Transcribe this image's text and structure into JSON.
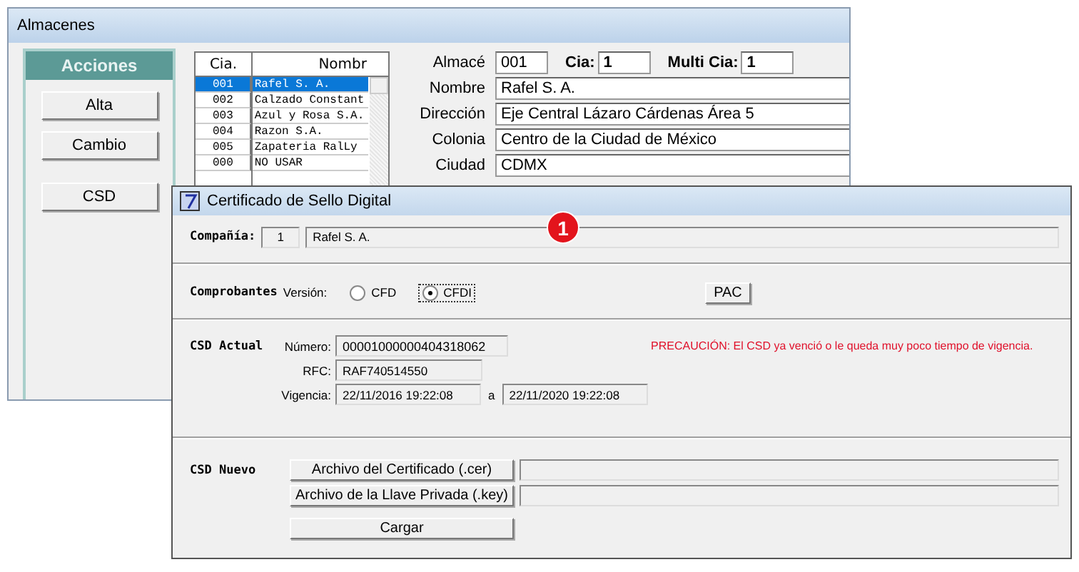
{
  "main_window": {
    "title": "Almacenes",
    "actions": {
      "title": "Acciones",
      "buttons": [
        "Alta",
        "Cambio",
        "CSD"
      ]
    },
    "company_grid": {
      "columns": [
        "Cia.",
        "Nombr"
      ],
      "rows": [
        {
          "cells": [
            "001",
            "Rafel S. A."
          ],
          "selected": true
        },
        {
          "cells": [
            "002",
            "Calzado Constant"
          ],
          "selected": false
        },
        {
          "cells": [
            "003",
            "Azul y Rosa S.A."
          ],
          "selected": false
        },
        {
          "cells": [
            "004",
            "Razon S.A."
          ],
          "selected": false
        },
        {
          "cells": [
            "005",
            "Zapateria RalLy"
          ],
          "selected": false
        },
        {
          "cells": [
            "000",
            "NO USAR"
          ],
          "selected": false
        }
      ]
    },
    "form": {
      "almacen": {
        "label": "Almacé",
        "value": "001"
      },
      "cia": {
        "label": "Cia:",
        "value": "1"
      },
      "multi_cia": {
        "label": "Multi Cia:",
        "value": "1"
      },
      "fields": [
        {
          "label": "Nombre",
          "value": "Rafel S. A."
        },
        {
          "label": "Dirección",
          "value": "Eje Central Lázaro Cárdenas Área 5"
        },
        {
          "label": "Colonia",
          "value": "Centro de la Ciudad de México"
        },
        {
          "label": "Ciudad",
          "value": "CDMX"
        }
      ]
    }
  },
  "dialog": {
    "title": "Certificado de Sello Digital",
    "badge": "1",
    "company": {
      "label": "Compañía:",
      "number": "1",
      "name": "Rafel S. A."
    },
    "comprobantes": {
      "label": "Comprobantes",
      "version_label": "Versión:",
      "options": [
        {
          "label": "CFD",
          "selected": false
        },
        {
          "label": "CFDI",
          "selected": true
        }
      ],
      "pac_button": "PAC"
    },
    "csd_actual": {
      "label": "CSD Actual",
      "numero": {
        "label": "Número:",
        "value": "00001000000404318062"
      },
      "rfc": {
        "label": "RFC:",
        "value": "RAF740514550"
      },
      "vigencia": {
        "label": "Vigencia:",
        "from": "22/11/2016 19:22:08",
        "separator": "a",
        "to": "22/11/2020 19:22:08"
      },
      "warning": "PRECAUCIÓN: El CSD ya venció o le queda muy poco tiempo de vigencia."
    },
    "csd_nuevo": {
      "label": "CSD Nuevo",
      "files": [
        {
          "button": "Archivo del Certificado (.cer)"
        },
        {
          "button": "Archivo de la Llave Privada (.key)"
        }
      ],
      "load_button": "Cargar"
    }
  }
}
